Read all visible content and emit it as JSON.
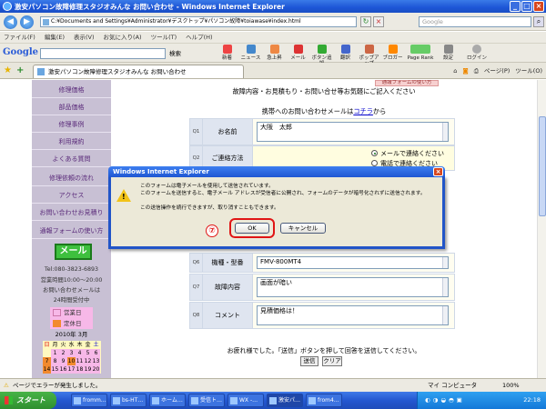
{
  "window": {
    "title": "激安パソコン故障修理スタジオみんな お問い合わせ - Windows Internet Explorer"
  },
  "address": {
    "url": "C:¥Documents and Settings¥Administrator¥デスクトップ¥パソコン故障¥toiawase¥index.html",
    "search_placeholder": "Google"
  },
  "menu": [
    "ファイル(F)",
    "編集(E)",
    "表示(V)",
    "お気に入り(A)",
    "ツール(T)",
    "ヘルプ(H)"
  ],
  "google_bar": {
    "logo": "Google",
    "search_label": "検索",
    "tools": [
      "新着",
      "ニュース",
      "急上昇",
      "メール",
      "ボタン追加",
      "翻訳",
      "ポップアップ",
      "ブロガー",
      "Page Rank",
      "設定",
      "ログイン"
    ]
  },
  "tab": {
    "title": "激安パソコン故障修理スタジオみんな お問い合わせ",
    "tools": [
      "ページ(P)",
      "ツール(O)"
    ]
  },
  "sidebar": {
    "items": [
      "修理価格",
      "部品価格",
      "修理事例",
      "利用規約",
      "よくある質問",
      "修理依頼の流れ",
      "アクセス",
      "お問い合わせお見積り",
      "通報フォームの使い方"
    ],
    "mail_button": "メール",
    "tel": "Tel:080-3823-6893",
    "hours": "営業時間10:00〜20:00",
    "mail_note": "お問い合わせメールは",
    "mail_note2": "24時間受付中",
    "legend_open": "営業日",
    "legend_closed": "定休日",
    "calendar_title": "2010年 3月",
    "calendar_header": [
      "日",
      "月",
      "火",
      "水",
      "木",
      "金",
      "土"
    ],
    "calendar_rows": [
      [
        "",
        "1",
        "2",
        "3",
        "4",
        "5",
        "6"
      ],
      [
        "7",
        "8",
        "9",
        "10",
        "11",
        "12",
        "13"
      ],
      [
        "14",
        "15",
        "16",
        "17",
        "18",
        "19",
        "20"
      ]
    ]
  },
  "page": {
    "tag": "通報フォームの使い方",
    "intro": "故障内容・お見積もり・お問い合せ等お気軽にご記入ください",
    "mobile_prefix": "携帯へのお問い合わせメールは",
    "mobile_link": "コチラ",
    "mobile_suffix": "から",
    "rows": [
      {
        "q": "Q1",
        "label": "お名前",
        "value": "大阪　太郎"
      },
      {
        "q": "Q2",
        "label": "ご連絡方法",
        "options": [
          "メールで連絡ください",
          "電話で連絡ください"
        ],
        "selected": 0
      },
      {
        "q": "Q6",
        "label": "機種・型番",
        "value": "FMV-800MT4"
      },
      {
        "q": "Q7",
        "label": "故障内容",
        "value": "画面が暗い"
      },
      {
        "q": "Q8",
        "label": "コメント",
        "value": "見積価格は！"
      }
    ],
    "bottom_text": "お疲れ様でした。「送信」ボタンを押して回答を送信してください。",
    "submit": "送信",
    "clear": "クリア"
  },
  "dialog": {
    "title": "Windows Internet Explorer",
    "line1": "このフォームは電子メールを使用して送信されています。",
    "line2": "このフォームを送信すると、電子メール アドレスが受信者に公開され、フォームのデータが暗号化されずに送信されます。",
    "line3": "この送信操作を続行できますが、取り消すこともできます。",
    "ok": "OK",
    "cancel": "キャンセル",
    "step_marker": "⑦"
  },
  "status": {
    "text": "ページでエラーが発生しました。",
    "zone": "マイ コンピュータ",
    "zoom": "100%"
  },
  "taskbar": {
    "start": "スタート",
    "buttons": [
      "fromm…",
      "bs-HT…",
      "ホーム…",
      "受信ト…",
      "WX -…",
      "激安パ…",
      "from4…"
    ],
    "clock": "22:18"
  },
  "colors": {
    "accent": "#2154c8",
    "sidebar": "#c8c0d4",
    "mail": "#3ec03e",
    "open": "#f7b8e8",
    "closed": "#f28a2e"
  }
}
